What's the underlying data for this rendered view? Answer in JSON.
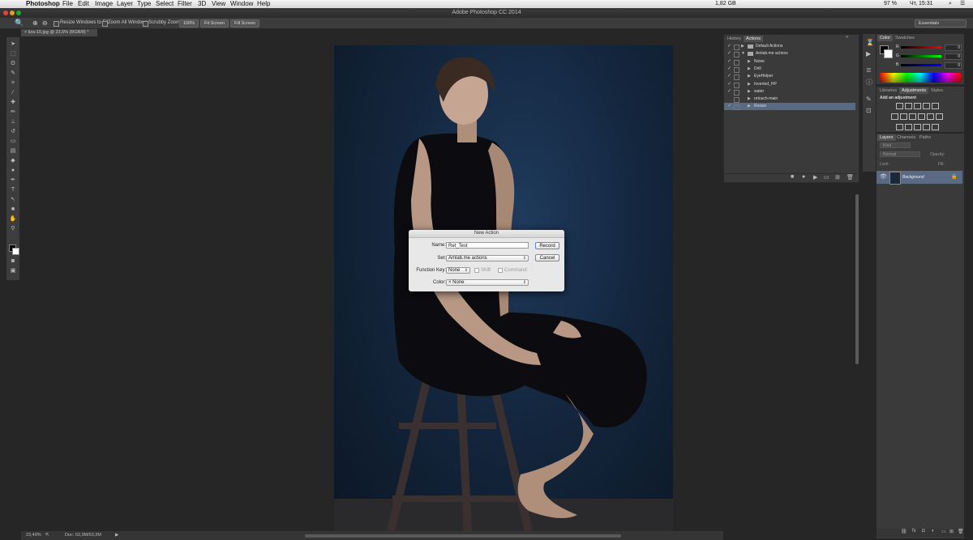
{
  "menubar": {
    "app": "Photoshop",
    "items": [
      "File",
      "Edit",
      "Image",
      "Layer",
      "Type",
      "Select",
      "Filter",
      "3D",
      "View",
      "Window",
      "Help"
    ],
    "status": "1,82 GB",
    "battery": "97 %",
    "clock": "Чт, 15:31"
  },
  "window": {
    "title": "Adobe Photoshop CC 2014",
    "workspace": "Essentials"
  },
  "options": {
    "resize_windows": "Resize Windows to Fit",
    "zoom_all": "Zoom All Windows",
    "scrubby": "Scrubby Zoom",
    "btn_100": "100%",
    "btn_fit": "Fit Screen",
    "btn_fill": "Fill Screen"
  },
  "document": {
    "tab": "liza-10.jpg @ 23,5% (RGB/8) *"
  },
  "status": {
    "zoom": "23,49%",
    "doc": "Doc: 63,3M/63,3M"
  },
  "actions_panel": {
    "tabs": [
      "History",
      "Actions"
    ],
    "rows": [
      {
        "label": "Default Actions",
        "type": "set",
        "checked": true
      },
      {
        "label": "Amlab.me actions",
        "type": "set",
        "checked": true
      },
      {
        "label": "Noise",
        "type": "action",
        "checked": true
      },
      {
        "label": "Drill",
        "type": "action",
        "checked": true
      },
      {
        "label": "EyeHelper",
        "type": "action",
        "checked": true
      },
      {
        "label": "Inverted_HP",
        "type": "action",
        "checked": true
      },
      {
        "label": "water",
        "type": "action",
        "checked": true
      },
      {
        "label": "retouch-main",
        "type": "action",
        "checked": false
      },
      {
        "label": "Resize",
        "type": "action",
        "checked": true
      }
    ]
  },
  "color_panel": {
    "tabs": [
      "Color",
      "Swatches"
    ],
    "channels": [
      {
        "label": "R",
        "value": "0"
      },
      {
        "label": "G",
        "value": "0"
      },
      {
        "label": "B",
        "value": "0"
      }
    ]
  },
  "adjustments_panel": {
    "tabs": [
      "Libraries",
      "Adjustments",
      "Styles"
    ],
    "heading": "Add an adjustment"
  },
  "layers_panel": {
    "tabs": [
      "Layers",
      "Channels",
      "Paths"
    ],
    "filter": "Kind",
    "blend": "Normal",
    "opacity_label": "Opacity:",
    "lock_label": "Lock:",
    "fill_label": "Fill:",
    "layer_name": "Background"
  },
  "dialog": {
    "title": "New Action",
    "name_label": "Name:",
    "name_value": "Ret_Test",
    "set_label": "Set:",
    "set_value": "Amlab.me actions",
    "fkey_label": "Function Key:",
    "fkey_value": "None",
    "shift_label": "Shift",
    "command_label": "Command",
    "color_label": "Color:",
    "color_value": "× None",
    "record": "Record",
    "cancel": "Cancel"
  }
}
